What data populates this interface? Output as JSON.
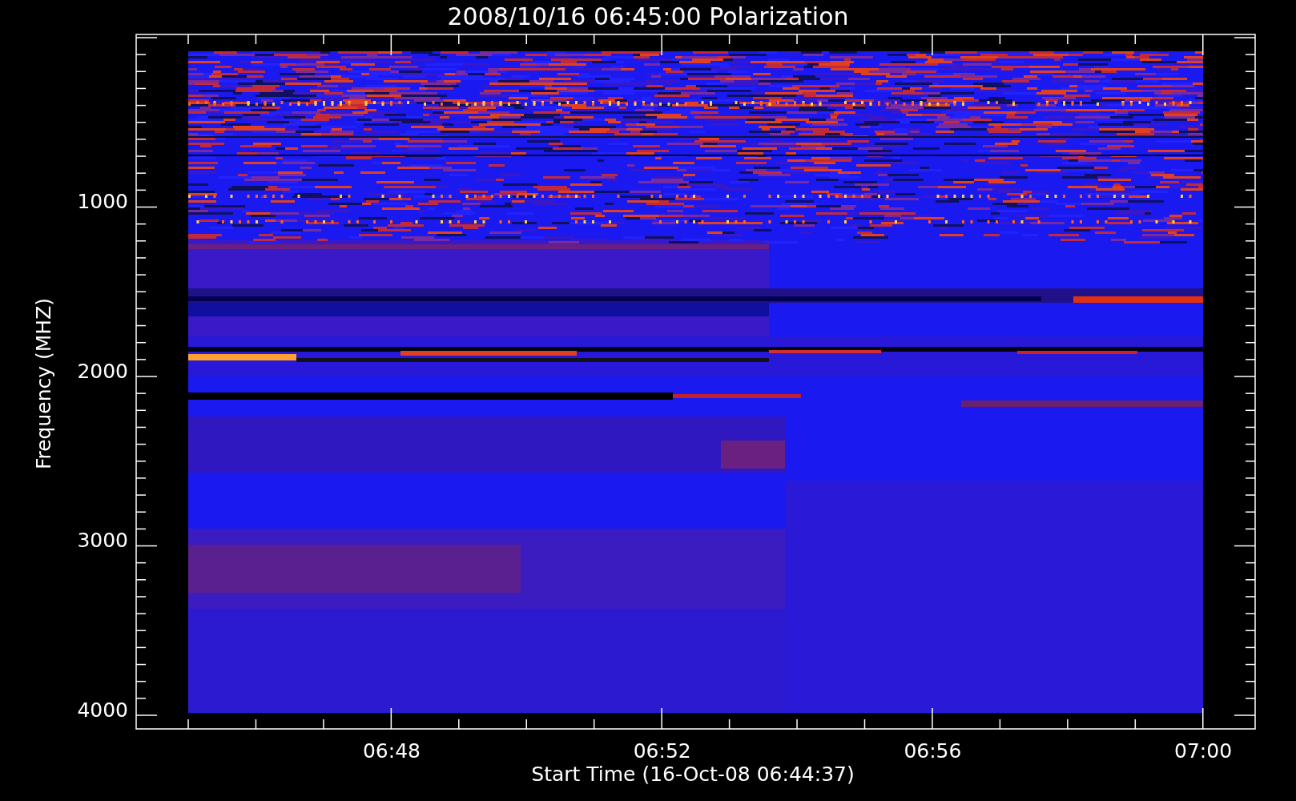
{
  "title": "2008/10/16 06:45:00 Polarization",
  "y_axis": {
    "label": "Frequency (MHZ)",
    "ticks": [
      "1000",
      "2000",
      "3000",
      "4000"
    ]
  },
  "x_axis": {
    "label": "Start Time (16-Oct-08 06:44:37)",
    "ticks": [
      "06:48",
      "06:52",
      "06:56",
      "07:00"
    ]
  }
}
